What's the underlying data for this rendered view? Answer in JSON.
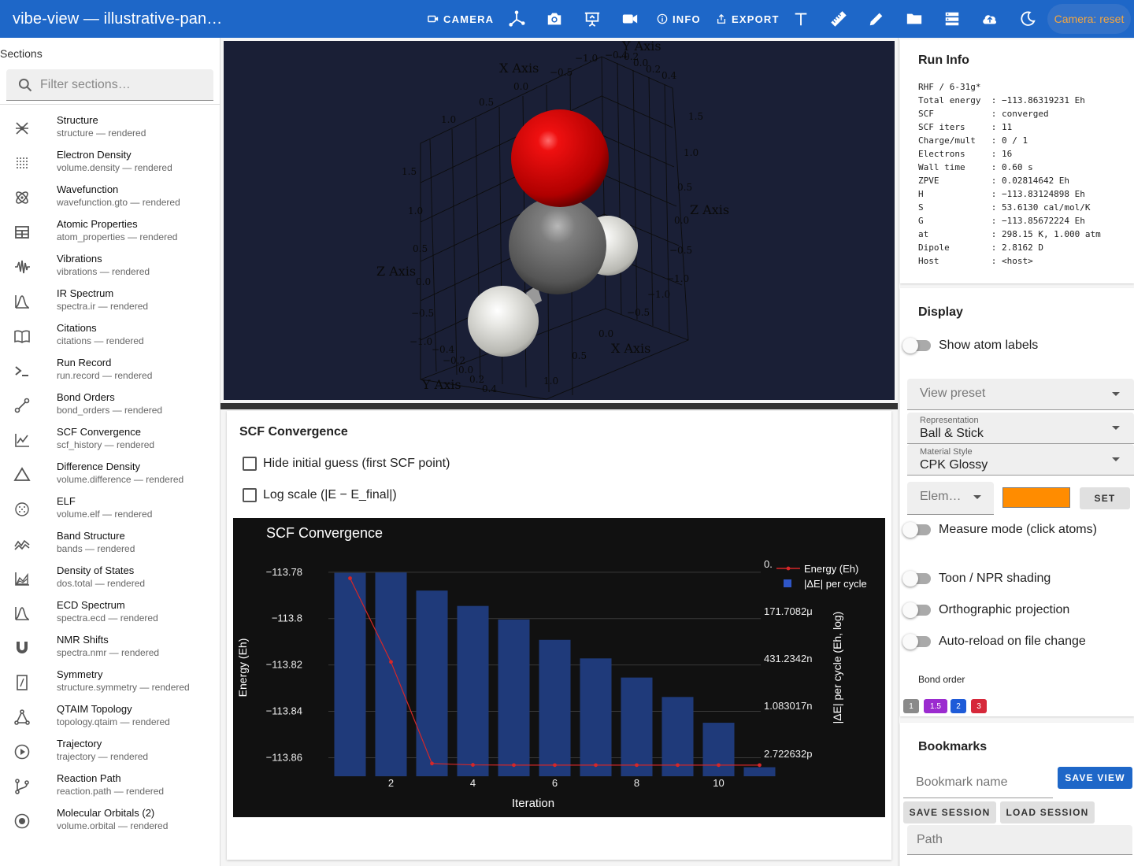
{
  "app": {
    "title": "vibe-view — illustrative-pan…"
  },
  "toolbar": {
    "camera_label": "CAMERA",
    "info_label": "INFO",
    "export_label": "EXPORT",
    "camera_reset": "Camera: reset",
    "icons": [
      "axes-icon",
      "screenshot-icon",
      "present-icon",
      "video-icon",
      "text-icon",
      "ruler-icon",
      "pencil-icon",
      "folder-icon",
      "server-icon",
      "upload-icon",
      "night-mode-icon"
    ]
  },
  "sidebar": {
    "heading": "Sections",
    "filter_placeholder": "Filter sections…",
    "items": [
      {
        "title": "Structure",
        "sub": "structure — rendered",
        "icon": "atom-structure-icon"
      },
      {
        "title": "Electron Density",
        "sub": "volume.density — rendered",
        "icon": "dot-grid-icon"
      },
      {
        "title": "Wavefunction",
        "sub": "wavefunction.gto — rendered",
        "icon": "atom-orbit-icon"
      },
      {
        "title": "Atomic Properties",
        "sub": "atom_properties — rendered",
        "icon": "table-icon"
      },
      {
        "title": "Vibrations",
        "sub": "vibrations — rendered",
        "icon": "waveform-icon"
      },
      {
        "title": "IR Spectrum",
        "sub": "spectra.ir — rendered",
        "icon": "spectrum-icon"
      },
      {
        "title": "Citations",
        "sub": "citations — rendered",
        "icon": "book-icon"
      },
      {
        "title": "Run Record",
        "sub": "run.record — rendered",
        "icon": "terminal-icon"
      },
      {
        "title": "Bond Orders",
        "sub": "bond_orders — rendered",
        "icon": "bond-icon"
      },
      {
        "title": "SCF Convergence",
        "sub": "scf_history — rendered",
        "icon": "line-chart-icon"
      },
      {
        "title": "Difference Density",
        "sub": "volume.difference — rendered",
        "icon": "triangle-icon"
      },
      {
        "title": "ELF",
        "sub": "volume.elf — rendered",
        "icon": "dotted-circle-icon"
      },
      {
        "title": "Band Structure",
        "sub": "bands — rendered",
        "icon": "bands-icon"
      },
      {
        "title": "Density of States",
        "sub": "dos.total — rendered",
        "icon": "area-chart-icon"
      },
      {
        "title": "ECD Spectrum",
        "sub": "spectra.ecd — rendered",
        "icon": "spectrum-icon"
      },
      {
        "title": "NMR Shifts",
        "sub": "spectra.nmr — rendered",
        "icon": "magnet-icon"
      },
      {
        "title": "Symmetry",
        "sub": "structure.symmetry — rendered",
        "icon": "symmetry-icon"
      },
      {
        "title": "QTAIM Topology",
        "sub": "topology.qtaim — rendered",
        "icon": "graph-icon"
      },
      {
        "title": "Trajectory",
        "sub": "trajectory — rendered",
        "icon": "play-circle-icon"
      },
      {
        "title": "Reaction Path",
        "sub": "reaction.path — rendered",
        "icon": "path-icon"
      },
      {
        "title": "Molecular Orbitals (2)",
        "sub": "volume.orbital — rendered",
        "icon": "orbital-icon"
      }
    ]
  },
  "viewer": {
    "axis_labels": {
      "x_top": "X Axis",
      "y_top": "Y Axis",
      "z_right": "Z Axis",
      "z_left": "Z Axis",
      "x_bottom": "X Axis",
      "y_bottom": "Y Axis"
    },
    "ticks_top_x": [
      "−1.0",
      "−0.5",
      "0.0",
      "0.5",
      "1.0"
    ],
    "ticks_top_y": [
      "−0.4",
      "−0.2",
      "0.0",
      "0.2",
      "0.4"
    ],
    "ticks_right_z": [
      "1.5",
      "1.0",
      "0.5",
      "0.0",
      "−0.5",
      "−1.0"
    ],
    "ticks_left_z": [
      "1.5",
      "1.0",
      "0.5",
      "0.0",
      "−0.5",
      "−1.0"
    ],
    "ticks_bottom_x": [
      "−1.0",
      "−0.5",
      "0.0",
      "0.5",
      "1.0"
    ],
    "ticks_bottom_y": [
      "−0.4",
      "−0.2",
      "0.0",
      "0.2",
      "0.4"
    ],
    "atom_colors": {
      "oxygen": "#d40000",
      "carbon": "#6e6e6e",
      "hydrogen": "#e4e4e0"
    }
  },
  "scf": {
    "heading": "SCF Convergence",
    "hide_guess_label": "Hide initial guess (first SCF point)",
    "log_scale_label": "Log scale (|E − E_final|)"
  },
  "chart_data": {
    "type": "bar",
    "title": "SCF Convergence",
    "xlabel": "Iteration",
    "ylabel": "Energy (Eh)",
    "y2label": "|ΔE| per cycle (Eh, log)",
    "x": [
      1,
      2,
      3,
      4,
      5,
      6,
      7,
      8,
      9,
      10,
      11
    ],
    "x_ticks": [
      "2",
      "4",
      "6",
      "8",
      "10"
    ],
    "ylim": [
      -113.868,
      -113.777
    ],
    "y_ticks": [
      "−113.78",
      "−113.8",
      "−113.82",
      "−113.84",
      "−113.86"
    ],
    "y2_ticks": [
      "0.",
      "171.7082μ",
      "431.2342n",
      "1.083017n",
      "2.722632p"
    ],
    "series": [
      {
        "name": "Energy (Eh)",
        "type": "line",
        "color": "#d62728",
        "values": [
          -113.7826,
          -113.8187,
          -113.8625,
          -113.8631,
          -113.8632,
          -113.8632,
          -113.8632,
          -113.8632,
          -113.8632,
          -113.8632,
          -113.8632
        ]
      },
      {
        "name": "|ΔE| per cycle",
        "type": "bar",
        "color": "#1f3a7a",
        "log_values": [
          -3.9,
          -3.88,
          -5.08,
          -6.1,
          -7.0,
          -8.35,
          -9.58,
          -10.85,
          -12.14,
          -13.85,
          -16.8
        ]
      }
    ],
    "legend_entries": [
      "Energy (Eh)",
      "|ΔE| per cycle"
    ],
    "legend_position": "top-right",
    "grid": true
  },
  "run_info": {
    "title": "Run Info",
    "lines": "RHF / 6-31g*\nTotal energy  : −113.86319231 Eh\nSCF           : converged\nSCF iters     : 11\nCharge/mult   : 0 / 1\nElectrons     : 16\nWall time     : 0.60 s\nZPVE          : 0.02814642 Eh\nH             : −113.83124898 Eh\nS             : 53.6130 cal/mol/K\nG             : −113.85672224 Eh\nat            : 298.15 K, 1.000 atm\nDipole        : 2.8162 D\nHost          : <host>"
  },
  "display": {
    "title": "Display",
    "show_atom_labels": "Show atom labels",
    "view_preset_placeholder": "View preset",
    "representation_label": "Representation",
    "representation_value": "Ball & Stick",
    "material_label": "Material Style",
    "material_value": "CPK Glossy",
    "element_placeholder": "Elem…",
    "element_color": "#ff8c00",
    "set_label": "SET",
    "measure_mode": "Measure mode (click atoms)",
    "toon": "Toon / NPR shading",
    "ortho": "Orthographic projection",
    "auto_reload": "Auto-reload on file change",
    "bond_order_label": "Bond order",
    "bond_chips": [
      {
        "label": "1",
        "color": "#8a8a8a"
      },
      {
        "label": "1.5",
        "color": "#9b2bcf"
      },
      {
        "label": "2",
        "color": "#1e5bd8"
      },
      {
        "label": "3",
        "color": "#d6283a"
      }
    ]
  },
  "bookmarks": {
    "title": "Bookmarks",
    "name_placeholder": "Bookmark name",
    "save_view": "SAVE VIEW",
    "save_session": "SAVE SESSION",
    "load_session": "LOAD SESSION",
    "path_placeholder": "Path"
  },
  "colors": {
    "accent": "#1e67c8",
    "camera_reset_text": "#f4a640"
  }
}
